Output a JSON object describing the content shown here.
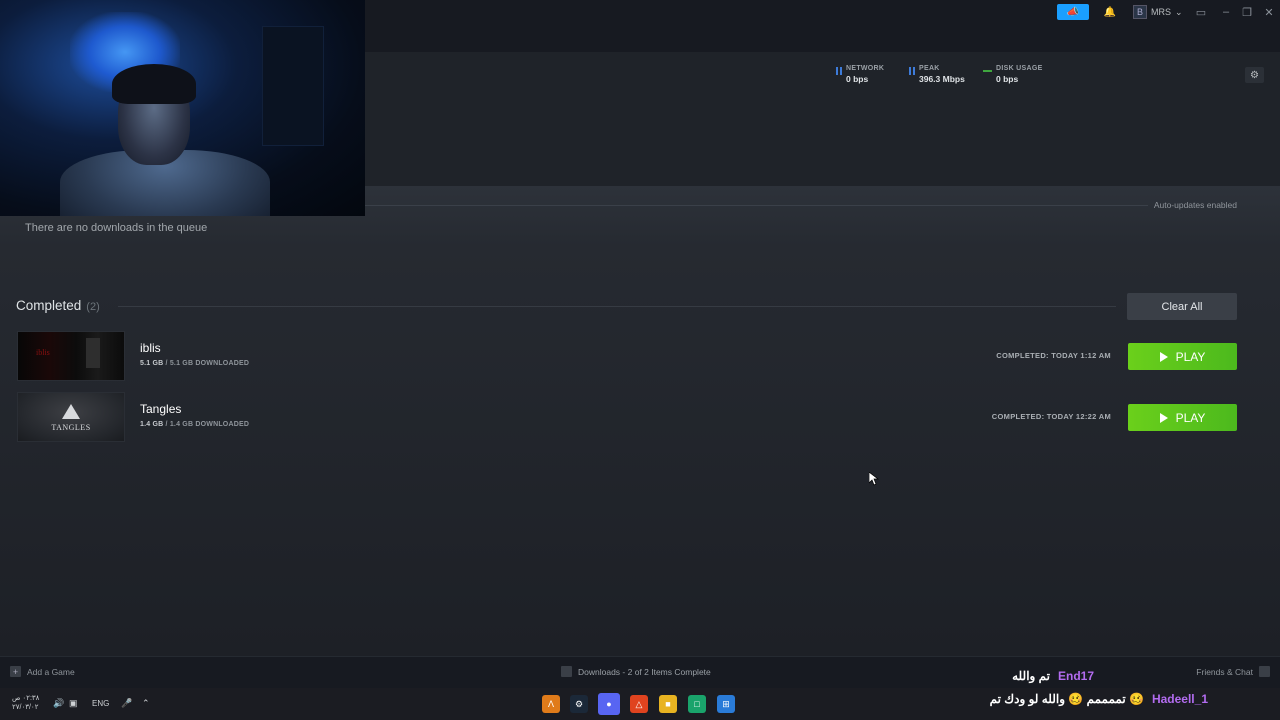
{
  "titlebar": {
    "user_name": "MRS",
    "user_avatar_letter": "B",
    "icons": [
      "megaphone-icon",
      "bell-icon",
      "chevron-down-icon",
      "monitor-icon",
      "minimize-icon",
      "maximize-icon",
      "close-icon"
    ]
  },
  "stats": {
    "network": {
      "label": "NETWORK",
      "value": "0 bps"
    },
    "peak": {
      "label": "PEAK",
      "value": "396.3 Mbps"
    },
    "disk": {
      "label": "DISK USAGE",
      "value": "0 bps"
    }
  },
  "queue": {
    "auto_updates": "Auto-updates enabled",
    "empty_text": "There are no downloads in the queue"
  },
  "completed": {
    "title": "Completed",
    "count": "(2)",
    "clear_all_label": "Clear All",
    "items": [
      {
        "name": "iblis",
        "size_done": "5.1 GB",
        "size_total": "/ 5.1 GB DOWNLOADED",
        "completed_text": "COMPLETED: TODAY 1:12 AM",
        "play_label": "PLAY"
      },
      {
        "name": "Tangles",
        "size_done": "1.4 GB",
        "size_total": "/ 1.4 GB DOWNLOADED",
        "completed_text": "COMPLETED: TODAY 12:22 AM",
        "play_label": "PLAY",
        "thumb_text": "TANGLES"
      }
    ]
  },
  "bottombar": {
    "add_game": "Add a Game",
    "downloads_status": "Downloads - 2 of 2 Items Complete",
    "friends_chat": "Friends & Chat"
  },
  "chat": [
    {
      "user": "End17",
      "message": "تم والله"
    },
    {
      "user": "Hadeell_1",
      "message": "تممممم 🥴 والله لو ودك تم 🥴"
    }
  ],
  "taskbar": {
    "time": "٠٢:٣٨ ص",
    "date": "٢٧/٠٣/٠٢",
    "lang": "ENG"
  },
  "colors": {
    "play_green": "#5bc51c",
    "accent_blue": "#1a9fff",
    "chat_user": "#b36cf0"
  }
}
